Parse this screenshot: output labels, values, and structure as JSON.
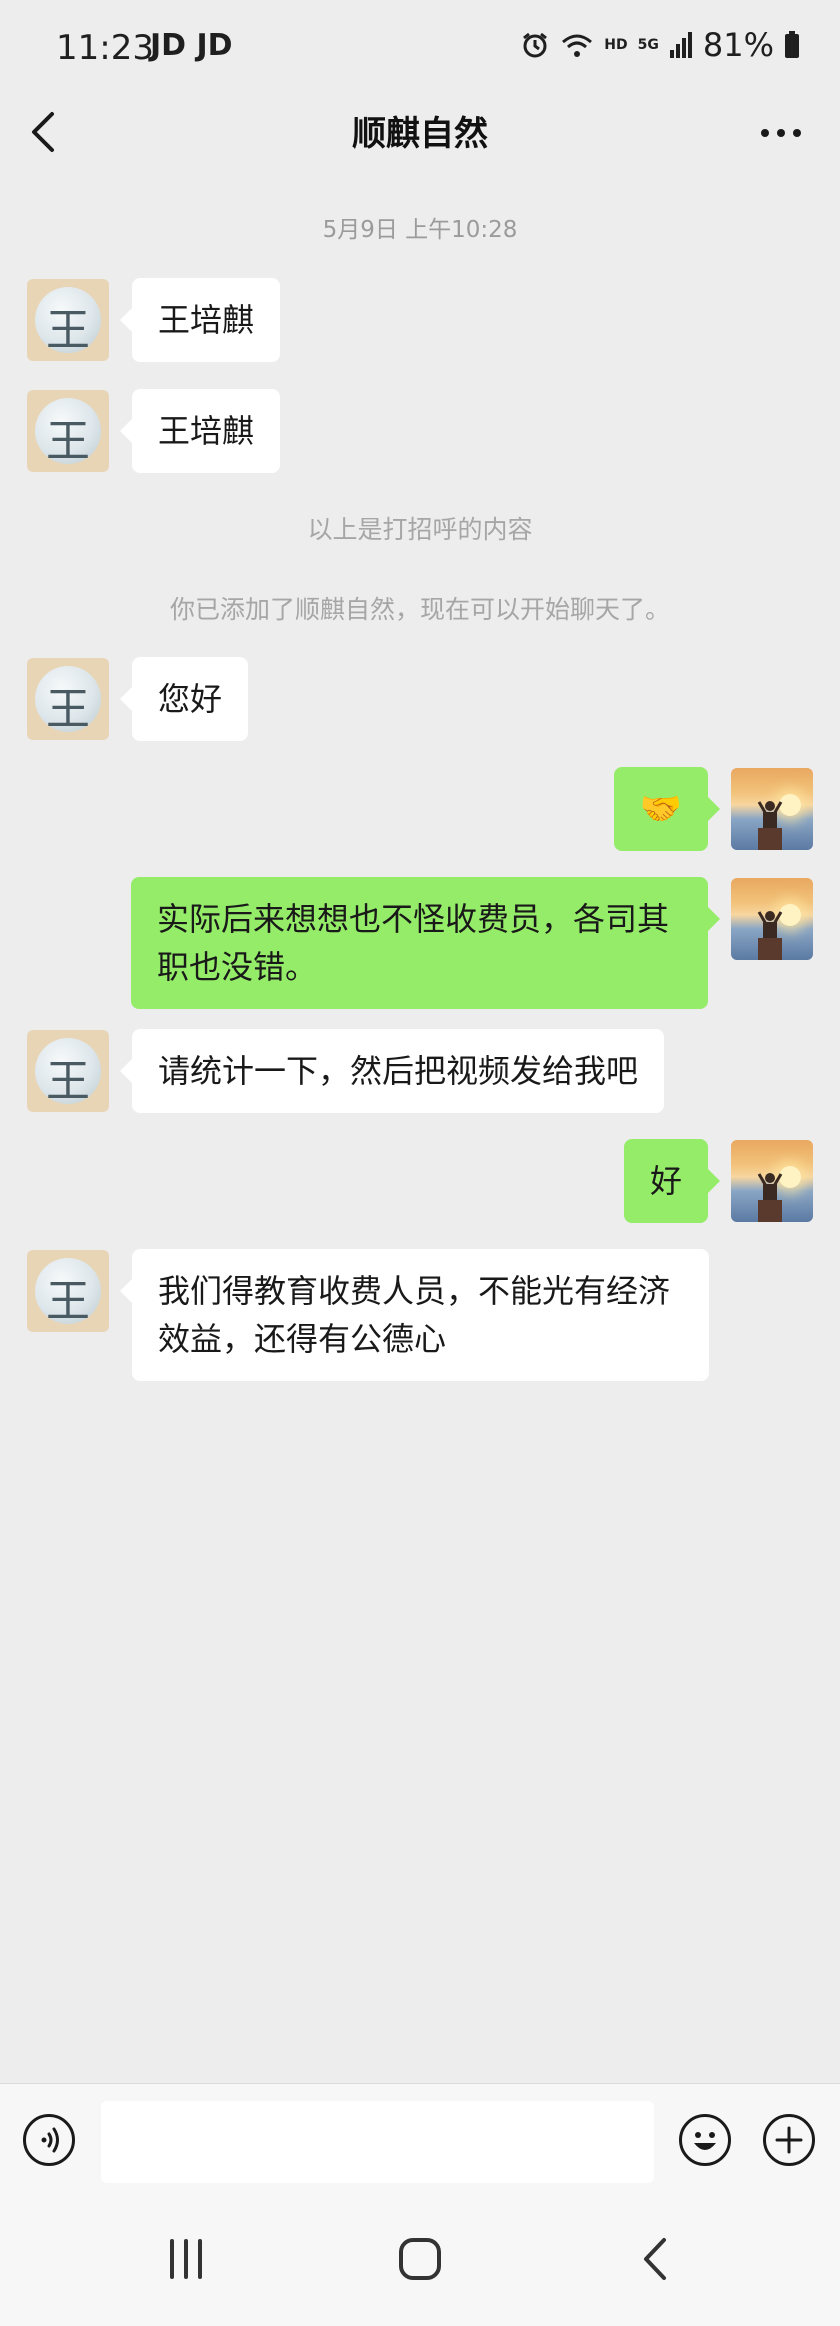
{
  "status_bar": {
    "time": "11:23",
    "carrier": "JD JD",
    "battery": "81%",
    "network": "5G"
  },
  "header": {
    "title": "顺麒自然"
  },
  "chat": {
    "timestamp": "5月9日 上午10:28",
    "system_notes": [
      "以上是打招呼的内容",
      "你已添加了顺麒自然，现在可以开始聊天了。"
    ],
    "messages": [
      {
        "side": "in",
        "text": "王培麒"
      },
      {
        "side": "in",
        "text": "王培麒"
      },
      {
        "side": "in",
        "text": "您好"
      },
      {
        "side": "out",
        "text": "🤝"
      },
      {
        "side": "out",
        "text": "实际后来想想也不怪收费员，各司其职也没错。"
      },
      {
        "side": "in",
        "text": "请统计一下，然后把视频发给我吧"
      },
      {
        "side": "out",
        "text": "好"
      },
      {
        "side": "in",
        "text": "我们得教育收费人员，不能光有经济效益，还得有公德心"
      }
    ],
    "contact_avatar_glyph": "王"
  },
  "colors": {
    "background": "#ededed",
    "incoming_bubble": "#ffffff",
    "outgoing_bubble": "#95ec69"
  },
  "input_bar": {
    "value": ""
  }
}
